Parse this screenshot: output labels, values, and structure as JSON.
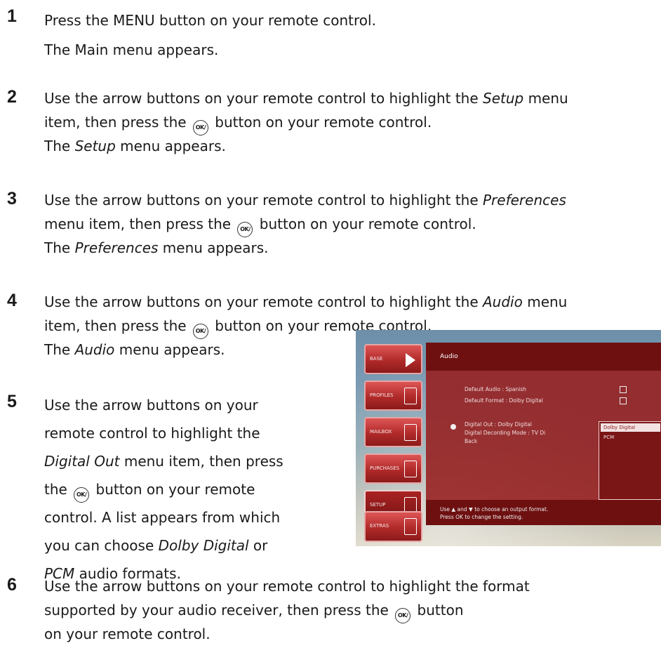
{
  "steps": [
    {
      "number": "1",
      "lines": [
        [
          {
            "t": "Press the MENU button on your remote control."
          }
        ],
        [
          {
            "t": "The Main menu appears."
          }
        ]
      ]
    },
    {
      "number": "2",
      "lines": [
        [
          {
            "t": "Use the arrow buttons on your remote control to highlight the "
          },
          {
            "t": "Setup",
            "i": true
          },
          {
            "t": " menu"
          }
        ],
        [
          {
            "t": "item, then press the "
          },
          {
            "ok": true
          },
          {
            "t": " button on your remote control."
          }
        ],
        [
          {
            "t": "The "
          },
          {
            "t": "Setup",
            "i": true
          },
          {
            "t": " menu appears."
          }
        ]
      ]
    },
    {
      "number": "3",
      "lines": [
        [
          {
            "t": "Use the arrow buttons on your remote control to highlight the "
          },
          {
            "t": "Preferences",
            "i": true
          }
        ],
        [
          {
            "t": "menu item, then press the "
          },
          {
            "ok": true
          },
          {
            "t": " button on your remote control."
          }
        ],
        [
          {
            "t": "The "
          },
          {
            "t": "Preferences",
            "i": true
          },
          {
            "t": " menu appears."
          }
        ]
      ]
    },
    {
      "number": "4",
      "lines": [
        [
          {
            "t": "Use the arrow buttons on your remote control to highlight the "
          },
          {
            "t": "Audio",
            "i": true
          },
          {
            "t": " menu"
          }
        ],
        [
          {
            "t": "item, then press the "
          },
          {
            "ok": true
          },
          {
            "t": " button on your remote control."
          }
        ],
        [
          {
            "t": "The "
          },
          {
            "t": "Audio",
            "i": true
          },
          {
            "t": " menu appears."
          }
        ]
      ]
    },
    {
      "number": "5",
      "lines": [
        [
          {
            "t": "Use the arrow buttons on your"
          }
        ],
        [
          {
            "t": "remote control to highlight the"
          }
        ],
        [
          {
            "t": "Digital Out",
            "i": true
          },
          {
            "t": " menu item, then press"
          }
        ],
        [
          {
            "t": "the "
          },
          {
            "ok": true
          },
          {
            "t": " button on your remote"
          }
        ],
        [
          {
            "t": "control. A list appears from which"
          }
        ],
        [
          {
            "t": "you can choose "
          },
          {
            "t": "Dolby Digital",
            "i": true
          },
          {
            "t": " or"
          }
        ],
        [
          {
            "t": "PCM",
            "i": true
          },
          {
            "t": " audio formats."
          }
        ]
      ]
    },
    {
      "number": "6",
      "lines": [
        [
          {
            "t": "Use the arrow buttons on your remote control to highlight the format"
          }
        ],
        [
          {
            "t": "supported by your audio receiver, then press the "
          },
          {
            "ok": true
          },
          {
            "t": " button"
          }
        ],
        [
          {
            "t": "on your remote control."
          }
        ]
      ]
    }
  ],
  "ok_glyph": "OK/",
  "tv_screen": {
    "sidebar": [
      "BASE",
      "PROFILES",
      "MAILBOX",
      "PURCHASES",
      "SETUP",
      "EXTRAS"
    ],
    "menu_title": "Audio",
    "options": [
      "Default Audio : Spanish",
      "Default Format : Dolby Digital",
      "Digital Out : Dolby Digital",
      "Digital Decording Mode : TV Di",
      "Back"
    ],
    "dropdown": [
      "Dolby Digital",
      "PCM"
    ],
    "footer": [
      "Use ▲ and ▼ to choose an output format.",
      "Press OK to change the setting."
    ]
  }
}
